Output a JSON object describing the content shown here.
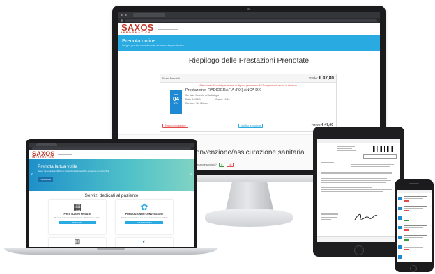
{
  "monitor": {
    "logo": "SAXOS",
    "logo_sub": "INFORMATICA",
    "band_title": "Prenota online",
    "band_subtitle": "Scegli e prenota comodamente da casa o tua prestazione",
    "page_heading": "Riepilogo delle Prestazioni Prenotate",
    "card_header_left": "Esami Prenotati",
    "card_total_label": "Totale:",
    "card_total_value": "€ 47,80",
    "notice": "Attenzione! Ricordati per esame di digiuno per almeno 8/12 ore prima di recarti in struttura",
    "cal_month": "apr",
    "cal_day": "04",
    "cal_year": "2024",
    "prestazione_label": "Prestazione:",
    "prestazione_value": "RADIOGRAFIA (RX) ANCA DX",
    "servizio": "Servizio: Servizio di Radiologia",
    "data": "Data: 04/04/24",
    "orario": "Orario: 10:40",
    "struttura": "Struttura: Via Milano",
    "remove_button": "Rimuovi prenotazione",
    "modify_button": "Modifica prestazione",
    "price_label": "Prezzo:",
    "price_value": "€ 47,00",
    "bottom_heading": "na convenzione/assicurazione sanitaria",
    "bottom_question": "Hai una convenzione sanitaria?",
    "yes_btn": "sì",
    "no_btn": "No"
  },
  "laptop": {
    "logo": "SAXOS",
    "logo_sub": "INFORMATICA",
    "hero_title": "Prenota la tua visita",
    "hero_text": "Scegli tra un'ampia offerta di prestazioni diagnostiche e prenota in pochi click.",
    "hero_button": "Prenota ora",
    "section_title": "Servizi dedicati al paziente",
    "service1_title": "PRESTAZIONI PRIVATE",
    "service1_text": "Prenota le tue prestazioni private direttamente online",
    "service1_button": "PRENOTA",
    "service2_title": "PRESTAZIONI IN CONVENZIONE",
    "service2_text": "Prenota le prestazioni con la tua convenzione sanitaria",
    "service2_button": "CONVENZIONE"
  }
}
